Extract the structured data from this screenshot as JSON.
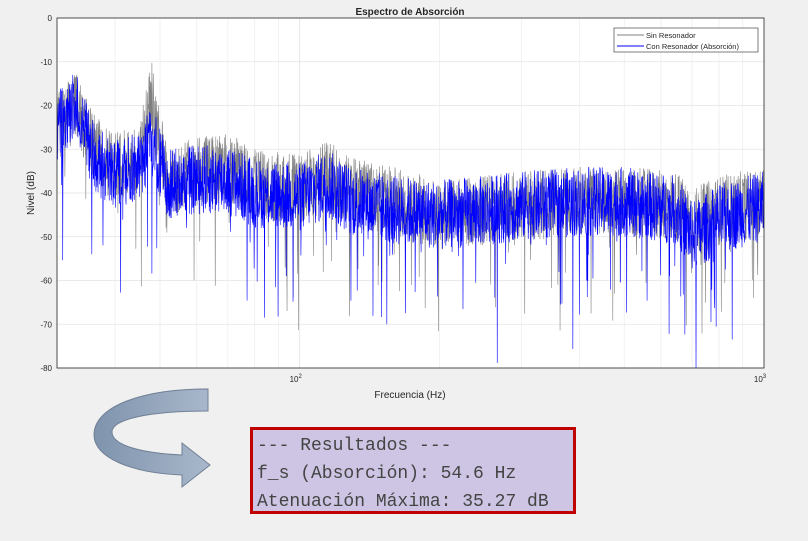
{
  "chart_data": {
    "type": "line",
    "title": "Espectro de Absorción",
    "xlabel": "Frecuencia (Hz)",
    "ylabel": "Nivel (dB)",
    "x_scale": "log",
    "xlim": [
      30,
      1000
    ],
    "ylim": [
      -80,
      0
    ],
    "y_ticks": [
      0,
      -10,
      -20,
      -30,
      -40,
      -50,
      -60,
      -70,
      -80
    ],
    "x_ticks": [
      {
        "value": 100,
        "label": "10",
        "exp": "2"
      },
      {
        "value": 1000,
        "label": "10",
        "exp": "3"
      }
    ],
    "grid": true,
    "legend_position": "top-right",
    "series": [
      {
        "name": "Sin Resonador",
        "color": "#808080",
        "envelope": [
          [
            30,
            -25
          ],
          [
            33,
            -20
          ],
          [
            36,
            -30
          ],
          [
            40,
            -34
          ],
          [
            45,
            -33
          ],
          [
            48,
            -18
          ],
          [
            52,
            -38
          ],
          [
            60,
            -35
          ],
          [
            70,
            -34
          ],
          [
            80,
            -38
          ],
          [
            100,
            -39
          ],
          [
            115,
            -36
          ],
          [
            130,
            -40
          ],
          [
            160,
            -42
          ],
          [
            200,
            -45
          ],
          [
            250,
            -44
          ],
          [
            300,
            -43
          ],
          [
            400,
            -42
          ],
          [
            500,
            -42
          ],
          [
            650,
            -43
          ],
          [
            700,
            -47
          ],
          [
            800,
            -44
          ],
          [
            1000,
            -42
          ]
        ]
      },
      {
        "name": "Con Resonador (Absorción)",
        "color": "#0000ff",
        "envelope": [
          [
            30,
            -25
          ],
          [
            33,
            -20
          ],
          [
            36,
            -32
          ],
          [
            40,
            -36
          ],
          [
            45,
            -34
          ],
          [
            48,
            -28
          ],
          [
            52,
            -38
          ],
          [
            60,
            -37
          ],
          [
            70,
            -37
          ],
          [
            80,
            -40
          ],
          [
            100,
            -41
          ],
          [
            115,
            -38
          ],
          [
            130,
            -42
          ],
          [
            160,
            -44
          ],
          [
            200,
            -45
          ],
          [
            250,
            -44
          ],
          [
            300,
            -43
          ],
          [
            400,
            -42
          ],
          [
            500,
            -42
          ],
          [
            650,
            -44
          ],
          [
            700,
            -50
          ],
          [
            800,
            -46
          ],
          [
            1000,
            -43
          ]
        ]
      }
    ]
  },
  "results": {
    "line1": "--- Resultados ---",
    "line2": "f_s (Absorción): 54.6 Hz",
    "line3": "Atenuación Máxima: 35.27 dB"
  }
}
